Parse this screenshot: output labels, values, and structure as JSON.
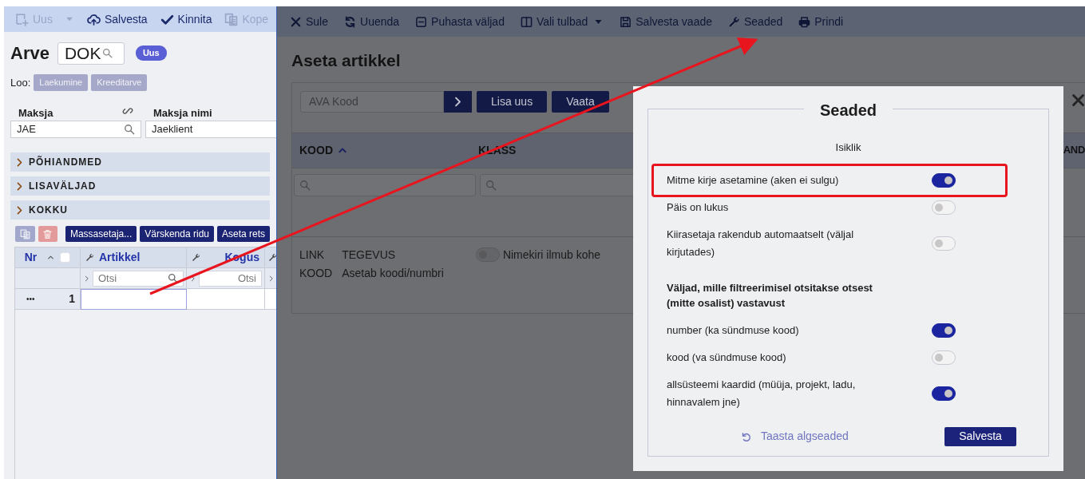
{
  "left_panel": {
    "toolbar": [
      {
        "label": "Uus",
        "disabled": true,
        "dropdown": true
      },
      {
        "label": "Salvesta",
        "disabled": false,
        "dropdown": false
      },
      {
        "label": "Kinnita",
        "disabled": false,
        "dropdown": false
      },
      {
        "label": "Kope",
        "disabled": true,
        "dropdown": false
      }
    ],
    "title": "Arve",
    "document_field": {
      "value": "DOK"
    },
    "status_badge": "Uus",
    "create_label": "Loo:",
    "create_buttons": [
      "Laekumine",
      "Kreeditarve"
    ],
    "fields": [
      {
        "label": "Maksja",
        "value": "JAE"
      },
      {
        "label": "Maksja nimi",
        "value": "Jaeklient"
      }
    ],
    "sections": [
      {
        "title": "PÕHIANDMED",
        "expanded": false
      },
      {
        "title": "LISAVÄLJAD",
        "expanded": false
      },
      {
        "title": "KOKKU",
        "expanded": false
      }
    ],
    "row_buttons": [
      "Massasetaja...",
      "Värskenda ridu",
      "Aseta rets"
    ],
    "grid": {
      "columns": [
        {
          "label": "Nr",
          "sorted": true
        },
        {
          "label": "Artikkel",
          "sorted": false
        },
        {
          "label": "Kogus",
          "sorted": false
        }
      ],
      "select_all": {
        "checked": false
      },
      "filters": [
        {
          "placeholder": "Otsi"
        },
        {
          "placeholder": "Otsi"
        }
      ],
      "rows": [
        {
          "menu": "•••",
          "number": "1"
        }
      ]
    }
  },
  "right_panel": {
    "toolbar": [
      {
        "label": "Sule",
        "dropdown": false
      },
      {
        "label": "Uuenda",
        "dropdown": false
      },
      {
        "label": "Puhasta väljad",
        "dropdown": false
      },
      {
        "label": "Vali tulbad",
        "dropdown": true
      },
      {
        "label": "Salvesta vaade",
        "dropdown": false
      },
      {
        "label": "Seaded",
        "dropdown": false
      },
      {
        "label": "Prindi",
        "dropdown": false
      }
    ],
    "heading": "Aseta artikkel",
    "search": {
      "placeholder": "AVA Kood"
    },
    "buttons": [
      "Lisa uus",
      "Vaata"
    ],
    "table": {
      "columns": [
        {
          "label": "KOOD",
          "sorted": true
        },
        {
          "label": "KLASS",
          "sorted": false
        },
        {
          "label": "AND",
          "sorted": false
        }
      ]
    },
    "legend": [
      {
        "key": "LINK",
        "value": "TEGEVUS"
      },
      {
        "key": "KOOD",
        "value": "Asetab koodi/numbri"
      }
    ],
    "instant_list": {
      "label": "Nimekiri ilmub kohe",
      "on": false
    }
  },
  "settings_dialog": {
    "title": "Seaded",
    "group": "Isiklik",
    "settings": [
      {
        "label": "Mitme kirje asetamine (aken ei sulgu)",
        "on": true,
        "highlighted": true
      },
      {
        "label": "Päis on lukus",
        "on": false,
        "highlighted": false
      },
      {
        "label": "Kiirasetaja rakendub automaatselt (väljal kirjutades)",
        "on": false,
        "highlighted": false
      }
    ],
    "filter_heading": "Väljad, mille filtreerimisel otsitakse otsest (mitte osalist) vastavust",
    "filter_settings": [
      {
        "label": "number (ka sündmuse kood)",
        "on": true
      },
      {
        "label": "kood (va sündmuse kood)",
        "on": false
      },
      {
        "label": "allsüsteemi kaardid (müüja, projekt, ladu, hinnavalem jne)",
        "on": true
      }
    ],
    "reset_link": "Taasta algseaded",
    "save_button": "Salvesta"
  }
}
